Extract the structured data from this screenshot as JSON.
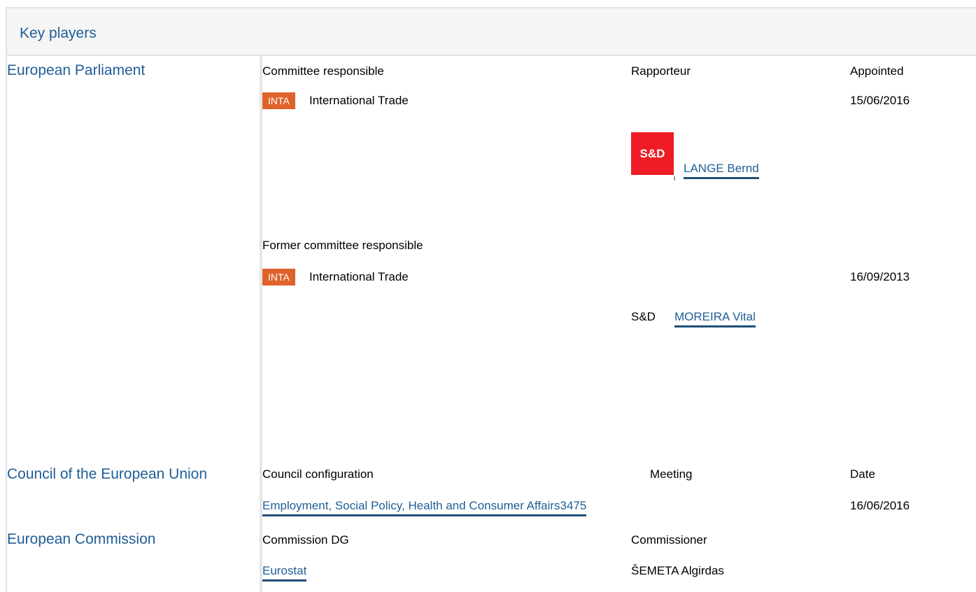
{
  "header": {
    "title": "Key players"
  },
  "european_parliament": {
    "label": "European Parliament",
    "col_committee": "Committee responsible",
    "col_rapporteur": "Rapporteur",
    "col_appointed": "Appointed",
    "current": {
      "committee_code": "INTA",
      "committee_name": "International Trade",
      "appointed": "15/06/2016",
      "group_logo_text": "S&D",
      "group_logo_color": "#ee1c25",
      "rapporteur": "LANGE Bernd"
    },
    "former_heading": "Former committee responsible",
    "former": {
      "committee_code": "INTA",
      "committee_name": "International Trade",
      "appointed": "16/09/2013",
      "group": "S&D",
      "rapporteur": "MOREIRA Vital"
    }
  },
  "council": {
    "label": "Council of the European Union",
    "col_configuration": "Council configuration",
    "col_meeting": "Meeting",
    "col_date": "Date",
    "configuration": "Employment, Social Policy, Health and Consumer Affairs",
    "meeting": "3475",
    "date": "16/06/2016"
  },
  "commission": {
    "label": "European Commission",
    "col_dg": "Commission DG",
    "col_commissioner": "Commissioner",
    "dg": "Eurostat",
    "commissioner": "ŠEMETA Algirdas"
  },
  "colors": {
    "link": "#1f5e97",
    "badge": "#e0622b",
    "underline": "#1f4e78"
  }
}
